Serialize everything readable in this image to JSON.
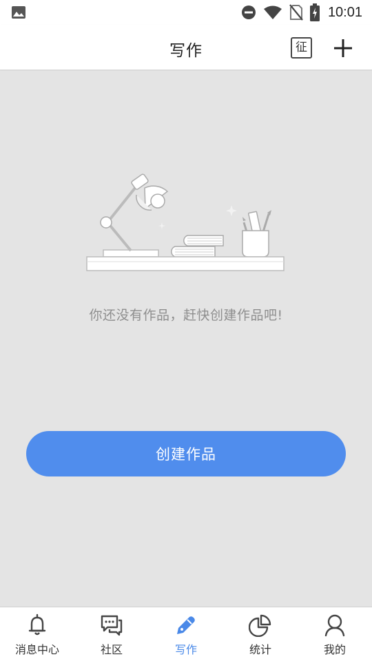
{
  "status_bar": {
    "time": "10:01",
    "icons": [
      "gallery-icon",
      "do-not-disturb-icon",
      "wifi-icon",
      "no-sim-icon",
      "battery-charging-icon"
    ]
  },
  "header": {
    "title": "写作",
    "contest_label": "征",
    "add_icon": "plus-icon"
  },
  "main": {
    "empty_message": "你还没有作品，赶快创建作品吧!",
    "create_button_label": "创建作品",
    "illustration": "desk-lamp-books-pencil-cup-illustration"
  },
  "bottom_nav": {
    "items": [
      {
        "label": "消息中心",
        "icon": "bell-icon",
        "active": false
      },
      {
        "label": "社区",
        "icon": "chat-icon",
        "active": false
      },
      {
        "label": "写作",
        "icon": "pen-icon",
        "active": true
      },
      {
        "label": "统计",
        "icon": "pie-chart-icon",
        "active": false
      },
      {
        "label": "我的",
        "icon": "user-icon",
        "active": false
      }
    ]
  },
  "colors": {
    "accent": "#508ded",
    "active_nav": "#4a89e8",
    "background": "#e4e4e4",
    "text_muted": "#8e8e8e"
  }
}
